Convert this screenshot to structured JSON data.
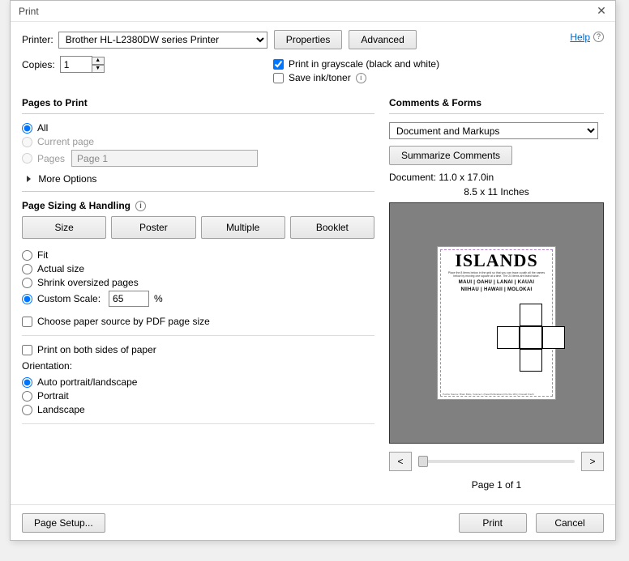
{
  "title": "Print",
  "help": "Help",
  "printer": {
    "label": "Printer:",
    "value": "Brother HL-L2380DW series Printer",
    "properties": "Properties",
    "advanced": "Advanced"
  },
  "copies": {
    "label": "Copies:",
    "value": "1"
  },
  "grayscale": "Print in grayscale (black and white)",
  "saveink": "Save ink/toner",
  "pagesToPrint": {
    "title": "Pages to Print",
    "all": "All",
    "current": "Current page",
    "pages": "Pages",
    "pagesValue": "Page 1",
    "more": "More Options"
  },
  "sizing": {
    "title": "Page Sizing & Handling",
    "size": "Size",
    "poster": "Poster",
    "multiple": "Multiple",
    "booklet": "Booklet",
    "fit": "Fit",
    "actual": "Actual size",
    "shrink": "Shrink oversized pages",
    "custom": "Custom Scale:",
    "scaleValue": "65",
    "percent": "%",
    "choosePaper": "Choose paper source by PDF page size",
    "duplex": "Print on both sides of paper"
  },
  "orientation": {
    "title": "Orientation:",
    "auto": "Auto portrait/landscape",
    "portrait": "Portrait",
    "landscape": "Landscape"
  },
  "comments": {
    "title": "Comments & Forms",
    "value": "Document and Markups",
    "summarize": "Summarize Comments"
  },
  "preview": {
    "doc": "Document: 11.0 x 17.0in",
    "paper": "8.5 x 11 Inches",
    "pagenum": "Page 1 of 1",
    "islands": {
      "title": "ISLANDS",
      "sub": "Place the 8 items below in the grid so that you can trace a path all the names below by moving one square at a time. The 24 items are listed twice.",
      "line1": "MAUI | OAHU | LANAI | KAUAI",
      "line2": "NIIHAU | HAWAII | MOLOKAI",
      "foot": "Puzzle Source: Brain Bolts, Volume 1 (New-Publications) Puzzle 18 by Donald Knuth"
    }
  },
  "buttons": {
    "pageSetup": "Page Setup...",
    "print": "Print",
    "cancel": "Cancel",
    "prev": "<",
    "next": ">"
  }
}
